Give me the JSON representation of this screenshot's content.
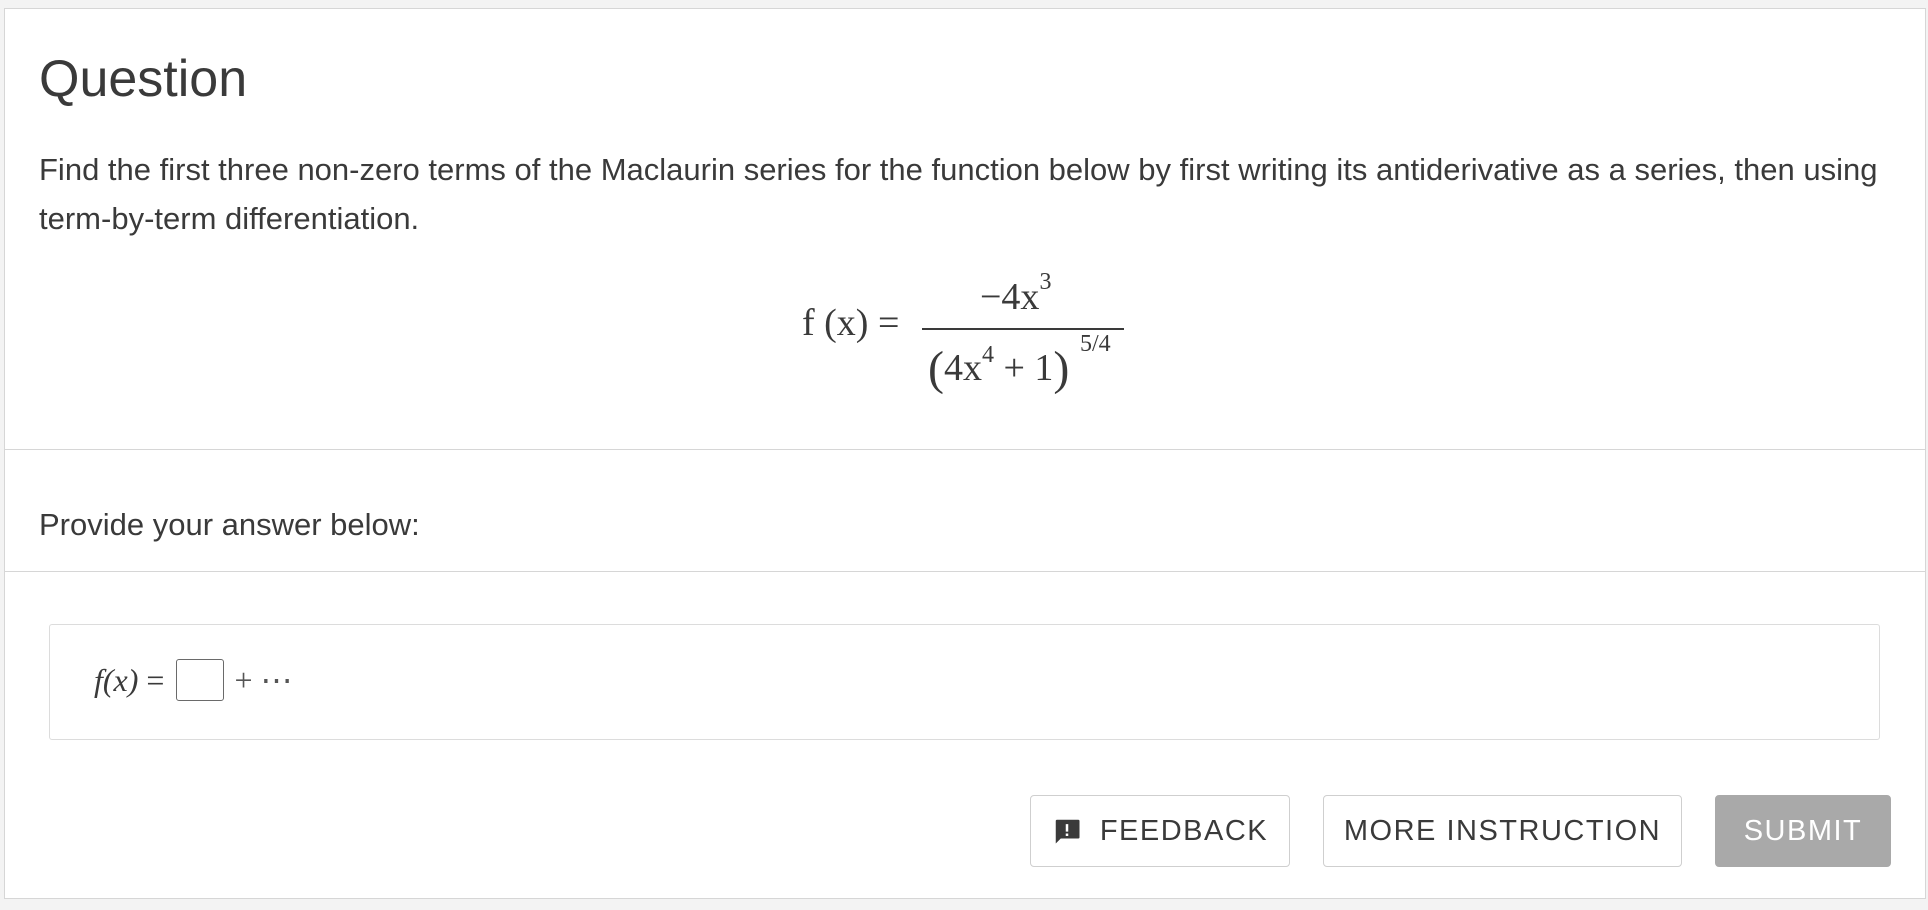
{
  "question": {
    "title": "Question",
    "text": "Find the first three non-zero terms of the Maclaurin series for the function below by first writing its antiderivative as a series, then using term-by-term differentiation.",
    "formula": {
      "lhs": "f (x) =",
      "numerator_base": "−4x",
      "numerator_exp": "3",
      "denominator_open": "(",
      "denominator_base": "4x",
      "denominator_inner_exp": "4",
      "denominator_rest": " + 1",
      "denominator_close": ")",
      "denominator_exp": "5/4"
    }
  },
  "answer": {
    "prompt": "Provide your answer below:",
    "lhs": "f(x)",
    "equals": "=",
    "input_value": "",
    "tail": "+ ⋯"
  },
  "buttons": {
    "feedback": "FEEDBACK",
    "feedback_icon": "feedback-icon",
    "more_instruction": "MORE INSTRUCTION",
    "submit": "SUBMIT"
  },
  "colors": {
    "text": "#3a3a3a",
    "border": "#d6d6d6",
    "submit_bg": "#a9a9a9"
  }
}
